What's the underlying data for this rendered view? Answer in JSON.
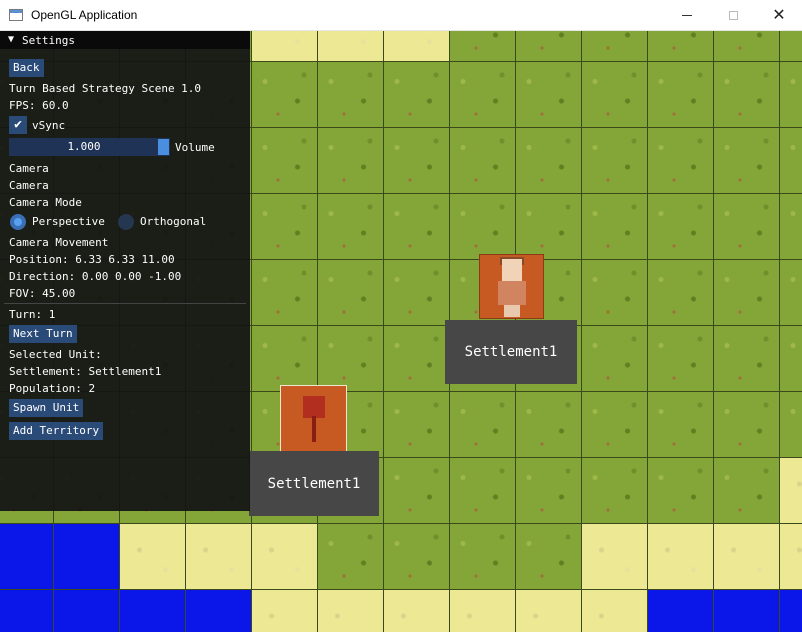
{
  "window": {
    "title": "OpenGL Application",
    "min_label": "",
    "max_label": "",
    "close_label": "✕"
  },
  "settings": {
    "header_arrow": "▼",
    "header": "Settings",
    "back": "Back",
    "scene_title": "Turn Based Strategy Scene 1.0",
    "fps": "FPS: 60.0",
    "vsync_check": "✔",
    "vsync_label": "vSync",
    "volume_value": "1.000",
    "volume_label": "Volume",
    "camera_a": "Camera",
    "camera_b": "Camera",
    "camera_mode": "Camera Mode",
    "mode_perspective": "Perspective",
    "mode_orthogonal": "Orthogonal",
    "mode_selected": "Perspective",
    "camera_movement": "Camera Movement",
    "position": "Position: 6.33 6.33 11.00",
    "direction": "Direction: 0.00 0.00 -1.00",
    "fov": "FOV: 45.00",
    "turn": "Turn: 1",
    "next_turn": "Next Turn",
    "selected_unit": "Selected Unit:",
    "settlement": "Settlement: Settlement1",
    "population": "Population: 2",
    "spawn_unit": "Spawn Unit",
    "add_territory": "Add Territory"
  },
  "map": {
    "labels": [
      "Settlement1",
      "Settlement1"
    ],
    "terrain_rows": [
      [
        "grass",
        "grass",
        "grass",
        "grass",
        "sand",
        "sand",
        "sand",
        "grass",
        "grass",
        "grass",
        "grass",
        "grass",
        "grass"
      ],
      [
        "grass",
        "grass",
        "grass",
        "grass",
        "grass",
        "grass",
        "grass",
        "grass",
        "grass",
        "grass",
        "grass",
        "grass",
        "grass"
      ],
      [
        "grass",
        "grass",
        "grass",
        "grass",
        "grass",
        "grass",
        "grass",
        "grass",
        "grass",
        "grass",
        "grass",
        "grass",
        "grass"
      ],
      [
        "grass",
        "grass",
        "grass",
        "grass",
        "grass",
        "grass",
        "grass",
        "grass",
        "grass",
        "grass",
        "grass",
        "grass",
        "grass"
      ],
      [
        "grass",
        "grass",
        "grass",
        "grass",
        "grass",
        "grass",
        "grass",
        "grass",
        "grass",
        "grass",
        "grass",
        "grass",
        "grass"
      ],
      [
        "grass",
        "grass",
        "grass",
        "grass",
        "grass",
        "grass",
        "grass",
        "grass",
        "grass",
        "grass",
        "grass",
        "grass",
        "grass"
      ],
      [
        "grass",
        "grass",
        "grass",
        "grass",
        "grass",
        "grass",
        "grass",
        "grass",
        "grass",
        "grass",
        "grass",
        "grass",
        "grass"
      ],
      [
        "grass",
        "grass",
        "grass",
        "grass",
        "grass",
        "grass",
        "grass",
        "grass",
        "grass",
        "grass",
        "grass",
        "grass",
        "sand"
      ],
      [
        "water",
        "water",
        "sand",
        "sand",
        "sand",
        "grass",
        "grass",
        "grass",
        "grass",
        "sand",
        "sand",
        "sand",
        "sand"
      ],
      [
        "water",
        "water",
        "water",
        "water",
        "sand",
        "sand",
        "sand",
        "sand",
        "sand",
        "sand",
        "water",
        "water",
        "water"
      ]
    ],
    "colors": {
      "grass": "#84a538",
      "sand": "#ece894",
      "water": "#0a17e8"
    }
  }
}
